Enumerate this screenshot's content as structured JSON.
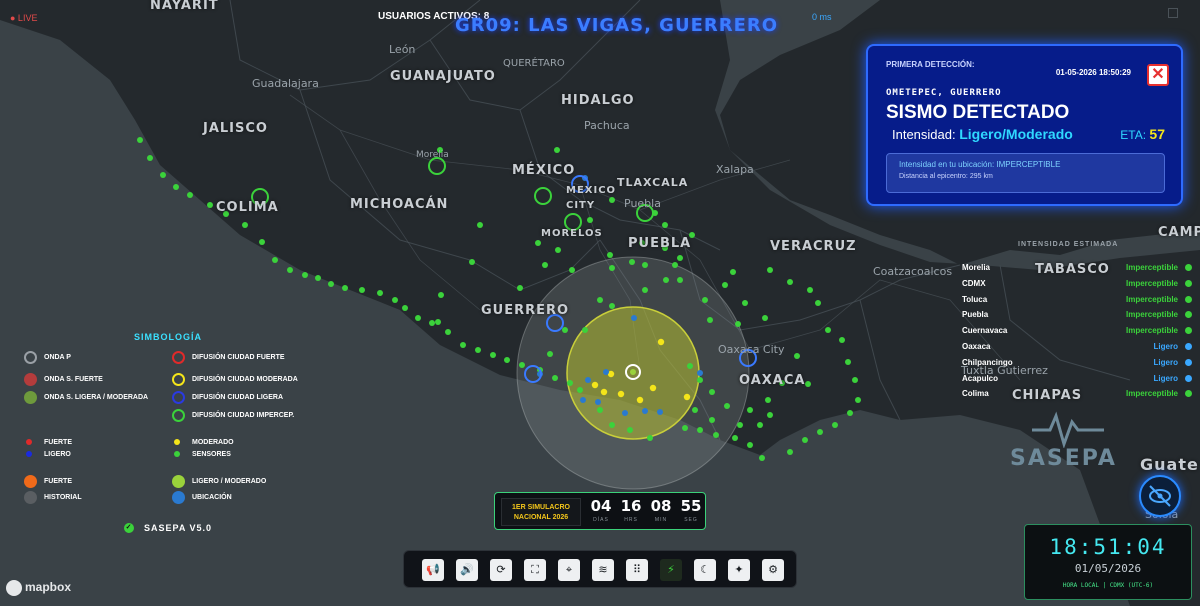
{
  "topbar": {
    "live": "● LIVE",
    "users": "USUARIOS ACTIVOS: 8",
    "latency": "0 ms",
    "title": "GR09: LAS VIGAS, GUERRERO"
  },
  "map_labels": {
    "states": [
      "NAYARIT",
      "GUANAJUATO",
      "JALISCO",
      "QUERÉTARO",
      "HIDALGO",
      "MÉXICO",
      "MICHOACÁN",
      "COLIMA",
      "TLAXCALA",
      "MORELOS",
      "PUEBLA",
      "VERACRUZ",
      "GUERRERO",
      "OAXACA",
      "TABASCO",
      "CHIAPAS",
      "CAMP",
      "Guate"
    ],
    "cities": [
      "León",
      "Guadalajara",
      "Pachuca",
      "Xalapa",
      "Morelia",
      "MEXICO CITY",
      "Puebla",
      "Coatzacoalcos",
      "Oaxaca City",
      "Tuxtla Gutierrez",
      "Sololá"
    ]
  },
  "alert": {
    "first_detection_label": "PRIMERA DETECCIÓN:",
    "timestamp": "01-05-2026 18:50:29",
    "close_icon": "close-icon",
    "origin": "OMETEPEC, GUERRERO",
    "headline": "SISMO DETECTADO",
    "intensity_label": "Intensidad:",
    "intensity_value": "Ligero/Moderado",
    "eta_label": "ETA:",
    "eta_value": "57",
    "local_intensity": "Intensidad en tu ubicación: IMPERCEPTIBLE",
    "distance": "Distancia al epicentro: 295 km"
  },
  "estimated_intensity": {
    "header": "INTENSIDAD ESTIMADA",
    "rows": [
      {
        "city": "Morelia",
        "value": "Imperceptible",
        "color": "#3bd23b"
      },
      {
        "city": "CDMX",
        "value": "Imperceptible",
        "color": "#3bd23b"
      },
      {
        "city": "Toluca",
        "value": "Imperceptible",
        "color": "#3bd23b"
      },
      {
        "city": "Puebla",
        "value": "Imperceptible",
        "color": "#3bd23b"
      },
      {
        "city": "Cuernavaca",
        "value": "Imperceptible",
        "color": "#3bd23b"
      },
      {
        "city": "Oaxaca",
        "value": "Ligero",
        "color": "#3aa8ff"
      },
      {
        "city": "Chilpancingo",
        "value": "Ligero",
        "color": "#3aa8ff"
      },
      {
        "city": "Acapulco",
        "value": "Ligero",
        "color": "#3aa8ff"
      },
      {
        "city": "Colima",
        "value": "Imperceptible",
        "color": "#3bd23b"
      }
    ]
  },
  "legend": {
    "title": "SIMBOLOGÍA",
    "items": [
      {
        "label": "ONDA P",
        "kind": "ring",
        "color": "#9aa0a6"
      },
      {
        "label": "ONDA S. FUERTE",
        "kind": "fill",
        "color": "#b43c3c"
      },
      {
        "label": "ONDA S. LIGERA / MODERADA",
        "kind": "fill",
        "color": "#6e9a3c"
      },
      {
        "label": "DIFUSIÓN CIUDAD FUERTE",
        "kind": "ring",
        "color": "#e02a2a"
      },
      {
        "label": "DIFUSIÓN CIUDAD MODERADA",
        "kind": "ring",
        "color": "#f4e51a"
      },
      {
        "label": "DIFUSIÓN CIUDAD LIGERA",
        "kind": "ring",
        "color": "#2a3ae0"
      },
      {
        "label": "DIFUSIÓN CIUDAD IMPERCEP.",
        "kind": "ring",
        "color": "#3bd23b"
      },
      {
        "label": "FUERTE",
        "kind": "dot",
        "color": "#e02a2a"
      },
      {
        "label": "LIGERO",
        "kind": "dot",
        "color": "#1a2ae0"
      },
      {
        "label": "MODERADO",
        "kind": "dot",
        "color": "#f4e51a"
      },
      {
        "label": "SENSORES",
        "kind": "dot",
        "color": "#3bd23b"
      },
      {
        "label": "FUERTE",
        "kind": "fill",
        "color": "#f06a1a"
      },
      {
        "label": "HISTORIAL",
        "kind": "fill",
        "color": "#5a5e62"
      },
      {
        "label": "LIGERO / MODERADO",
        "kind": "fill",
        "color": "#9ad23b"
      },
      {
        "label": "UBICACIÓN",
        "kind": "fill",
        "color": "#2a7ad0"
      }
    ],
    "version": "SASEPA V5.0"
  },
  "countdown": {
    "label": "1ER SIMULACRO NACIONAL 2026",
    "units": [
      {
        "value": "04",
        "unit": "DÍAS"
      },
      {
        "value": "16",
        "unit": "HRS"
      },
      {
        "value": "08",
        "unit": "MIN"
      },
      {
        "value": "55",
        "unit": "SEG"
      }
    ]
  },
  "toolbar": {
    "buttons": [
      {
        "icon": "megaphone-icon",
        "glyph": "📢"
      },
      {
        "icon": "speaker-icon",
        "glyph": "🔊"
      },
      {
        "icon": "refresh-icon",
        "glyph": "⟳"
      },
      {
        "icon": "fullscreen-icon",
        "glyph": "⛶"
      },
      {
        "icon": "location-pin-icon",
        "glyph": "⌖"
      },
      {
        "icon": "layers-icon",
        "glyph": "≋"
      },
      {
        "icon": "grid-icon",
        "glyph": "⠿"
      },
      {
        "icon": "plug-icon",
        "glyph": "⚡"
      },
      {
        "icon": "moon-icon",
        "glyph": "☾"
      },
      {
        "icon": "satellite-icon",
        "glyph": "✦"
      },
      {
        "icon": "settings-icon",
        "glyph": "⚙"
      }
    ],
    "active_index": 7
  },
  "clock": {
    "time": "18:51:04",
    "date": "01/05/2026",
    "zone": "HORA LOCAL | CDMX (UTC-6)"
  },
  "branding": {
    "sasepa": "SASEPA",
    "mapbox": "mapbox"
  },
  "colors": {
    "sensor": "#3bd23b",
    "moderate": "#f4e51a",
    "light": "#3a7aff",
    "accent": "#2e6bff"
  }
}
